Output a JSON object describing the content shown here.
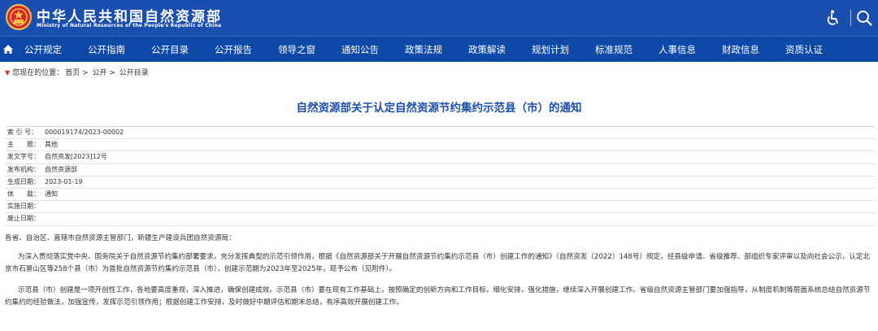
{
  "header": {
    "site_name_cn": "中华人民共和国自然资源部",
    "site_name_en": "Ministry of Natural Resources of the People's Republic of China",
    "brand_color": "#1a4fb0",
    "icons": [
      "emblem-icon",
      "accessibility-icon",
      "search-icon"
    ]
  },
  "nav": {
    "items": [
      "公开规定",
      "公开指南",
      "公开目录",
      "公开报告",
      "领导之窗",
      "通知公告",
      "政策法规",
      "政策解读",
      "规划计划",
      "标准规范",
      "人事信息",
      "财政信息",
      "资质认证"
    ]
  },
  "breadcrumb": {
    "prefix": "您现在的位置：",
    "items": [
      "首页",
      "公开",
      "公开目录"
    ],
    "separator": ">"
  },
  "article": {
    "title": "自然资源部关于认定自然资源节约集约示范县（市）的通知",
    "meta": [
      {
        "label": "索 引 号：",
        "value": "000019174/2023-00002"
      },
      {
        "label": "主　　题：",
        "value": "其他"
      },
      {
        "label": "发文字号：",
        "value": "自然资发[2023]12号"
      },
      {
        "label": "发布机构：",
        "value": "自然资源部"
      },
      {
        "label": "生成日期：",
        "value": "2023-01-19"
      },
      {
        "label": "体　　裁：",
        "value": "通知"
      },
      {
        "label": "实施日期：",
        "value": ""
      },
      {
        "label": "废止日期：",
        "value": ""
      }
    ],
    "greeting": "各省、自治区、直辖市自然资源主管部门，新疆生产建设兵团自然资源局：",
    "paragraph1": "为深入贯彻落实党中央、国务院关于自然资源节约集约部署要求，充分发挥典型的示范引领作用，根据《自然资源部关于开展自然资源节约集约示范县（市）创建工作的通知》（自然资发〔2022〕148号）规定，经县级申请、省级推荐、部组织专家评审以及向社会公示，认定北京市石景山区等258个县（市）为首批自然资源节约集约示范县（市），创建示范期为2023年至2025年，现予公布（见附件）。",
    "paragraph2": "示范县（市）创建是一项开创性工作，各地要高度重视，深入推进，确保创建成效。示范县（市）要在现有工作基础上，按照确定的创新方向和工作目标，细化安排，强化措施，继续深入开展创建工作。省级自然资源主管部门要加强指导，从制度机制等层面系统总结自然资源节约集约的经验做法，加强宣传，发挥示范引领作用；根据创建工作安排，及时做好中期评估和期末总结，有序高效开展创建工作。"
  }
}
